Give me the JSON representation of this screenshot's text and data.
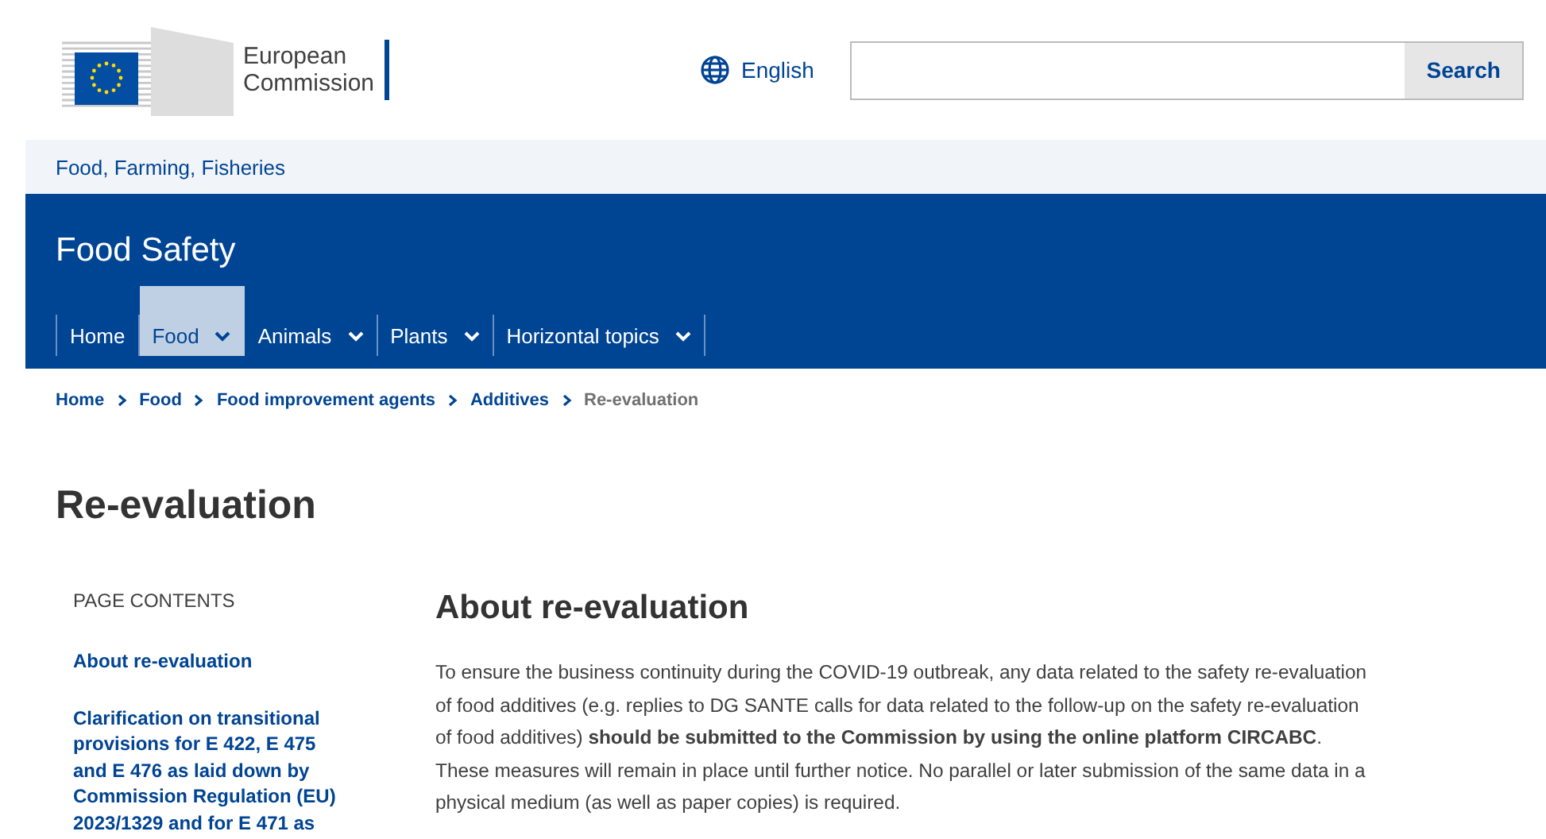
{
  "header": {
    "logo_text": [
      "European",
      "Commission"
    ],
    "language": "English",
    "search": {
      "button": "Search"
    }
  },
  "site_section": "Food, Farming, Fisheries",
  "site_title": "Food Safety",
  "nav": [
    {
      "label": "Home",
      "kind": "link",
      "selected": false
    },
    {
      "label": "Food",
      "kind": "dropdown",
      "selected": true
    },
    {
      "label": "Animals",
      "kind": "dropdown",
      "selected": false
    },
    {
      "label": "Plants",
      "kind": "dropdown",
      "selected": false
    },
    {
      "label": "Horizontal topics",
      "kind": "dropdown",
      "selected": false
    }
  ],
  "breadcrumb": [
    {
      "label": "Home",
      "current": false
    },
    {
      "label": "Food",
      "current": false
    },
    {
      "label": "Food improvement agents",
      "current": false
    },
    {
      "label": "Additives",
      "current": false
    },
    {
      "label": "Re-evaluation",
      "current": true
    }
  ],
  "page_title": "Re-evaluation",
  "page_contents": {
    "heading": "PAGE CONTENTS",
    "items": [
      "About re-evaluation",
      "Clarification on transitional provisions for E 422, E 475 and E 476 as laid down by Commission Regulation (EU) 2023/1329 and for E 471 as"
    ]
  },
  "section": {
    "heading": "About re-evaluation",
    "paragraph": "To ensure the business continuity during the COVID-19 outbreak, any data related to the safety re-evaluation of food additives (e.g. replies to DG SANTE calls for data related to the follow-up on the safety re-evaluation of food additives) **should be submitted to the Commission by using the online platform CIRCABC**. These measures will remain in place until further notice. No parallel or later submission of the same data in a physical medium (as well as paper copies) is required."
  }
}
